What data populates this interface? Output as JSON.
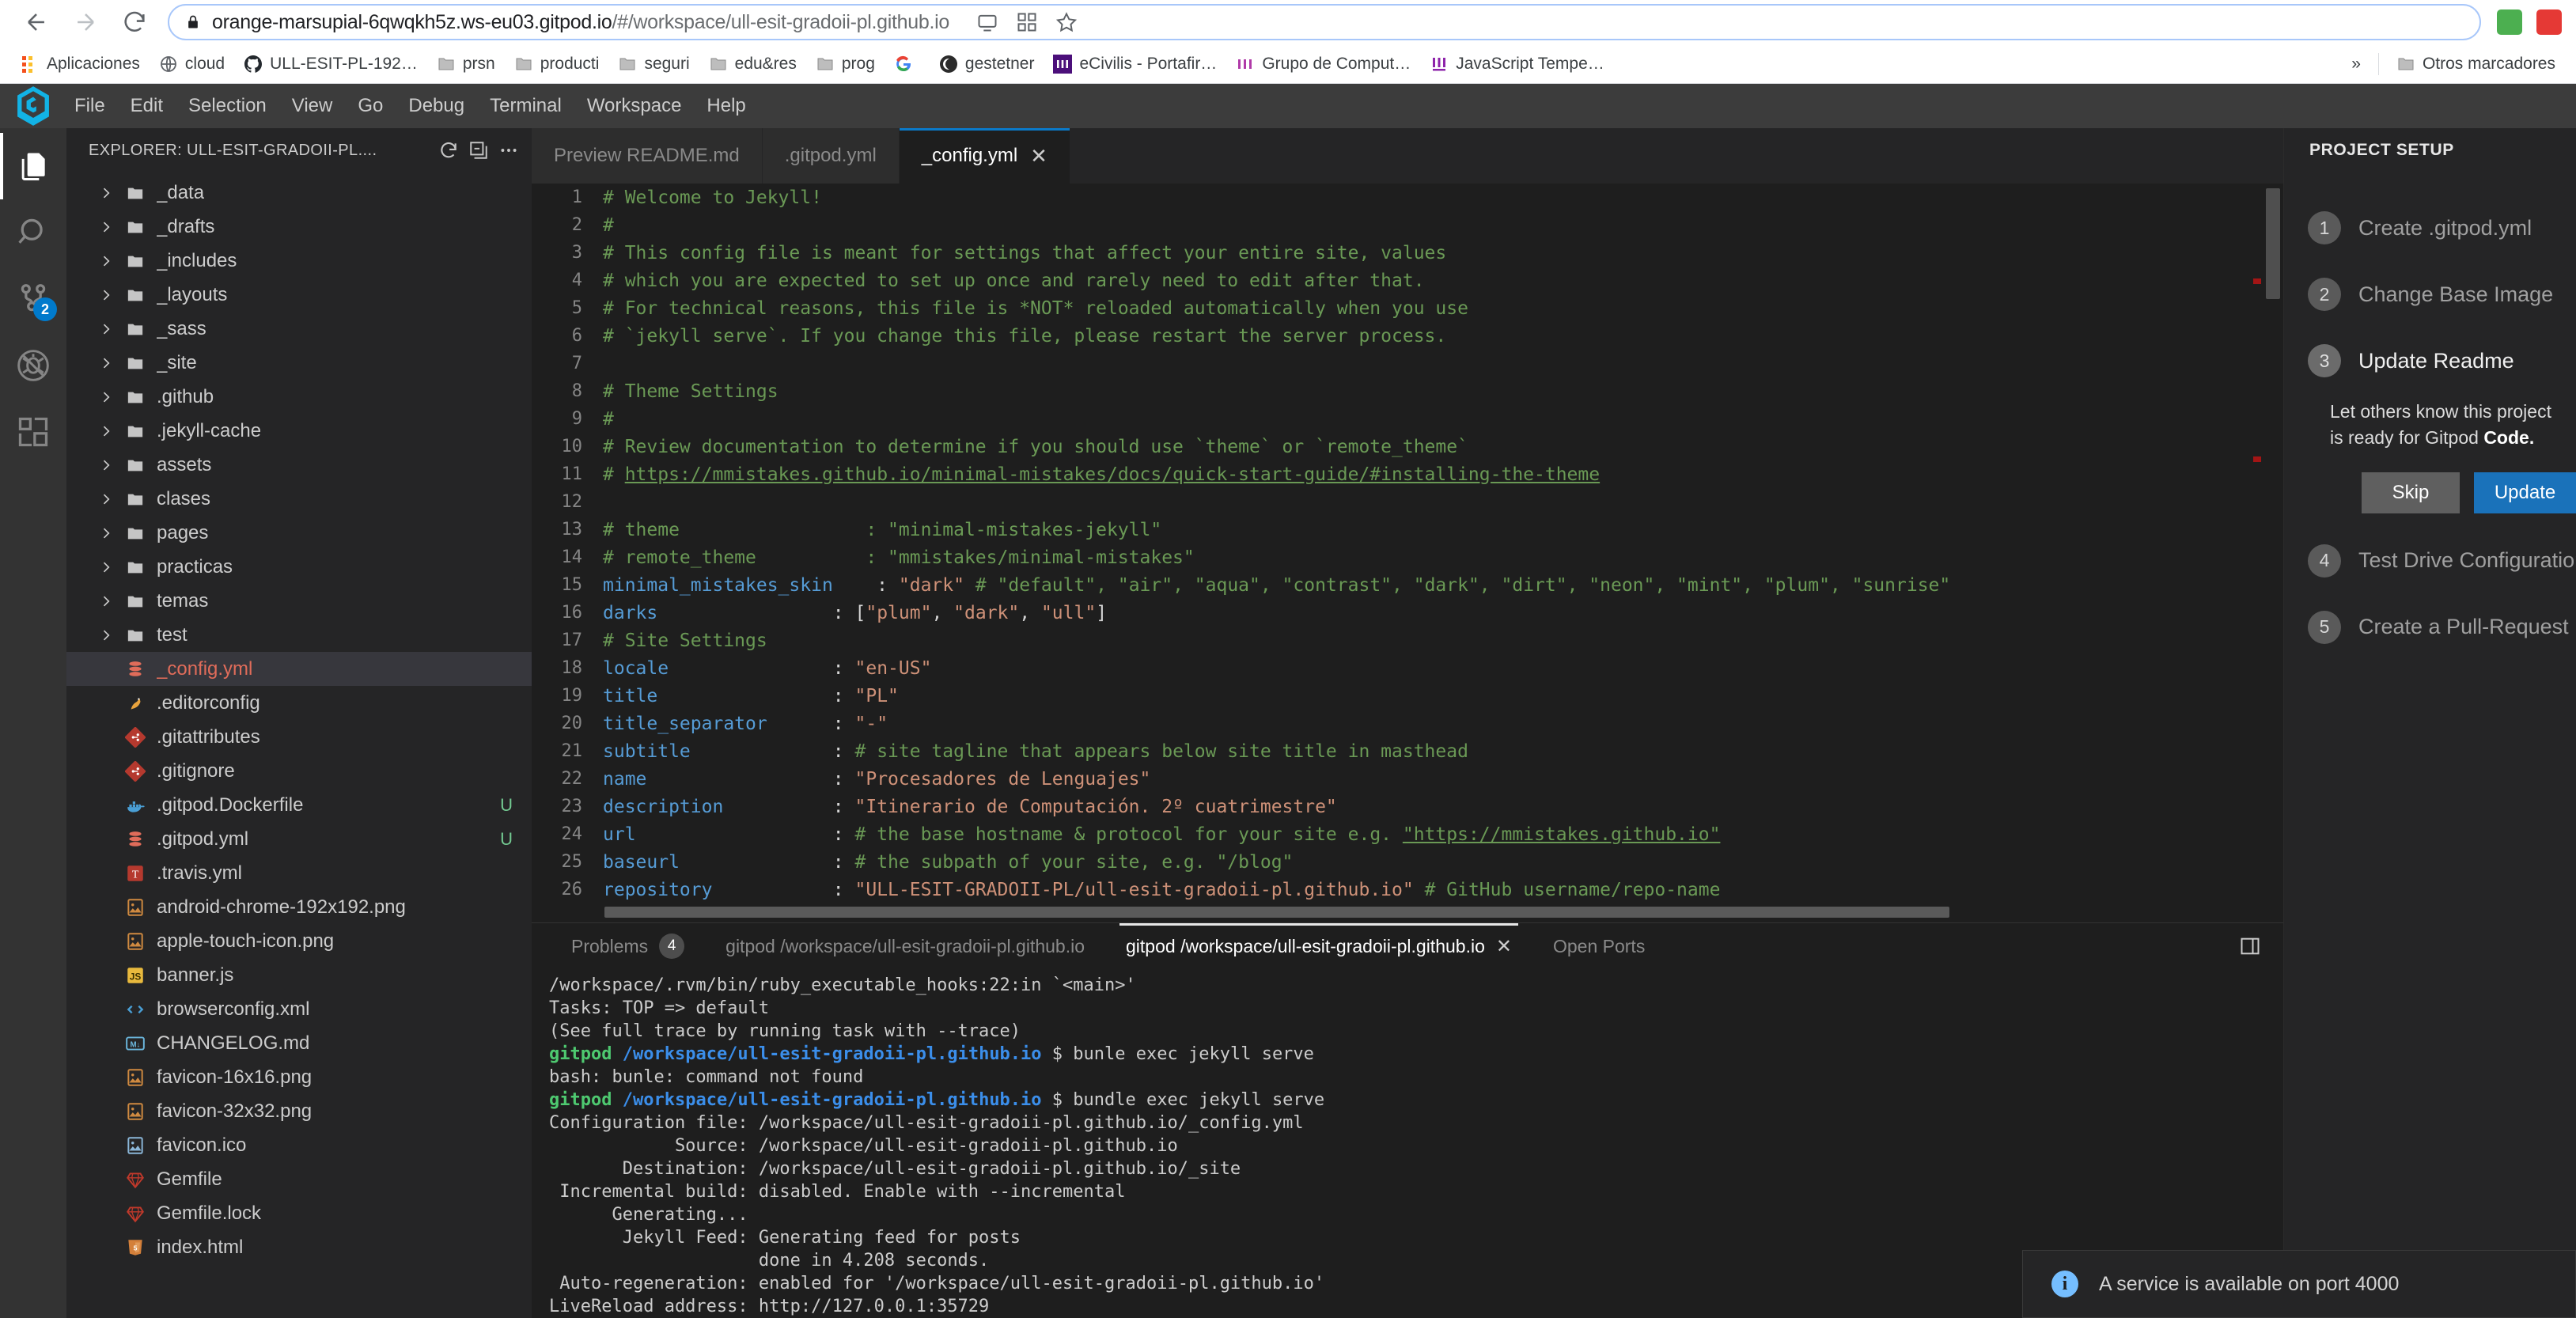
{
  "browser": {
    "url_main": "orange-marsupial-6qwqkh5z.ws-eu03.gitpod.io",
    "url_path": "/#/workspace/ull-esit-gradoii-pl.github.io",
    "back_label": "Back",
    "forward_label": "Forward",
    "reload_label": "Reload",
    "lock_label": "View site information",
    "bookmarks": [
      {
        "label": "Aplicaciones",
        "icon": "apps-grid-icon"
      },
      {
        "label": "cloud",
        "icon": "folder-icon"
      },
      {
        "label": "ULL-ESIT-PL-192…",
        "icon": "github-icon"
      },
      {
        "label": "prsn",
        "icon": "folder-icon"
      },
      {
        "label": "producti",
        "icon": "folder-icon"
      },
      {
        "label": "seguri",
        "icon": "folder-icon"
      },
      {
        "label": "edu&res",
        "icon": "folder-icon"
      },
      {
        "label": "prog",
        "icon": "folder-icon"
      },
      {
        "label": "",
        "icon": "google-icon"
      },
      {
        "label": "gestetner",
        "icon": "gestetner-icon"
      },
      {
        "label": "eCivilis - Portafir…",
        "icon": "ecivilis-icon"
      },
      {
        "label": "Grupo de Comput…",
        "icon": "ull-icon"
      },
      {
        "label": "JavaScript Tempe…",
        "icon": "ull-icon"
      }
    ],
    "overflow_label": "»",
    "other_bookmarks": "Otros marcadores"
  },
  "ide": {
    "menus": [
      "File",
      "Edit",
      "Selection",
      "View",
      "Go",
      "Debug",
      "Terminal",
      "Workspace",
      "Help"
    ],
    "logo_name": "gitpod-logo",
    "activitybar": [
      {
        "name": "explorer-icon",
        "badge": null,
        "active": true
      },
      {
        "name": "search-icon",
        "badge": null,
        "active": false
      },
      {
        "name": "source-control-icon",
        "badge": "2",
        "active": false
      },
      {
        "name": "debug-icon",
        "badge": null,
        "active": false
      },
      {
        "name": "extensions-icon",
        "badge": null,
        "active": false
      }
    ],
    "sidebar": {
      "title": "EXPLORER: ULL-ESIT-GRADOII-PL....",
      "actions": [
        "refresh-icon",
        "collapse-all-icon",
        "more-actions-icon"
      ],
      "tree": [
        {
          "name": "_data",
          "type": "folder"
        },
        {
          "name": "_drafts",
          "type": "folder"
        },
        {
          "name": "_includes",
          "type": "folder"
        },
        {
          "name": "_layouts",
          "type": "folder"
        },
        {
          "name": "_sass",
          "type": "folder"
        },
        {
          "name": "_site",
          "type": "folder"
        },
        {
          "name": ".github",
          "type": "folder"
        },
        {
          "name": ".jekyll-cache",
          "type": "folder"
        },
        {
          "name": "assets",
          "type": "folder"
        },
        {
          "name": "clases",
          "type": "folder"
        },
        {
          "name": "pages",
          "type": "folder"
        },
        {
          "name": "practicas",
          "type": "folder"
        },
        {
          "name": "temas",
          "type": "folder"
        },
        {
          "name": "test",
          "type": "folder"
        },
        {
          "name": "_config.yml",
          "type": "file",
          "icon": "yaml-icon",
          "selected": true,
          "status": ""
        },
        {
          "name": ".editorconfig",
          "type": "file",
          "icon": "editorconfig-icon",
          "status": ""
        },
        {
          "name": ".gitattributes",
          "type": "file",
          "icon": "git-icon",
          "status": ""
        },
        {
          "name": ".gitignore",
          "type": "file",
          "icon": "git-icon",
          "status": ""
        },
        {
          "name": ".gitpod.Dockerfile",
          "type": "file",
          "icon": "docker-icon",
          "status": "U"
        },
        {
          "name": ".gitpod.yml",
          "type": "file",
          "icon": "yaml-icon",
          "status": "U"
        },
        {
          "name": ".travis.yml",
          "type": "file",
          "icon": "travis-icon",
          "status": ""
        },
        {
          "name": "android-chrome-192x192.png",
          "type": "file",
          "icon": "image-icon",
          "status": ""
        },
        {
          "name": "apple-touch-icon.png",
          "type": "file",
          "icon": "image-icon",
          "status": ""
        },
        {
          "name": "banner.js",
          "type": "file",
          "icon": "js-icon",
          "status": ""
        },
        {
          "name": "browserconfig.xml",
          "type": "file",
          "icon": "xml-icon",
          "status": ""
        },
        {
          "name": "CHANGELOG.md",
          "type": "file",
          "icon": "markdown-icon",
          "status": ""
        },
        {
          "name": "favicon-16x16.png",
          "type": "file",
          "icon": "image-icon",
          "status": ""
        },
        {
          "name": "favicon-32x32.png",
          "type": "file",
          "icon": "image-icon",
          "status": ""
        },
        {
          "name": "favicon.ico",
          "type": "file",
          "icon": "image-ico-icon",
          "status": ""
        },
        {
          "name": "Gemfile",
          "type": "file",
          "icon": "ruby-icon",
          "status": ""
        },
        {
          "name": "Gemfile.lock",
          "type": "file",
          "icon": "ruby-icon",
          "status": ""
        },
        {
          "name": "index.html",
          "type": "file",
          "icon": "html-icon",
          "status": ""
        }
      ]
    },
    "tabs": [
      {
        "label": "Preview README.md",
        "active": false,
        "closable": false
      },
      {
        "label": ".gitpod.yml",
        "active": false,
        "closable": false
      },
      {
        "label": "_config.yml",
        "active": true,
        "closable": true
      }
    ],
    "editor": {
      "filename": "_config.yml",
      "lines": [
        {
          "n": 1,
          "segs": [
            {
              "t": "# Welcome to Jekyll!",
              "c": "c-com"
            }
          ]
        },
        {
          "n": 2,
          "segs": [
            {
              "t": "#",
              "c": "c-com"
            }
          ]
        },
        {
          "n": 3,
          "segs": [
            {
              "t": "# This config file is meant for settings that affect your entire site, values",
              "c": "c-com"
            }
          ]
        },
        {
          "n": 4,
          "segs": [
            {
              "t": "# which you are expected to set up once and rarely need to edit after that.",
              "c": "c-com"
            }
          ]
        },
        {
          "n": 5,
          "segs": [
            {
              "t": "# For technical reasons, this file is *NOT* reloaded automatically when you use",
              "c": "c-com"
            }
          ]
        },
        {
          "n": 6,
          "segs": [
            {
              "t": "# `jekyll serve`. If you change this file, please restart the server process.",
              "c": "c-com"
            }
          ]
        },
        {
          "n": 7,
          "segs": []
        },
        {
          "n": 8,
          "segs": [
            {
              "t": "# Theme Settings",
              "c": "c-com"
            }
          ]
        },
        {
          "n": 9,
          "segs": [
            {
              "t": "#",
              "c": "c-com"
            }
          ]
        },
        {
          "n": 10,
          "segs": [
            {
              "t": "# Review documentation to determine if you should use `theme` or `remote_theme`",
              "c": "c-com"
            }
          ]
        },
        {
          "n": 11,
          "segs": [
            {
              "t": "# ",
              "c": "c-com"
            },
            {
              "t": "https://mmistakes.github.io/minimal-mistakes/docs/quick-start-guide/#installing-the-theme",
              "c": "c-lnk"
            }
          ]
        },
        {
          "n": 12,
          "segs": []
        },
        {
          "n": 13,
          "segs": [
            {
              "t": "# theme                 : \"minimal-mistakes-jekyll\"",
              "c": "c-com"
            }
          ]
        },
        {
          "n": 14,
          "segs": [
            {
              "t": "# remote_theme          : \"mmistakes/minimal-mistakes\"",
              "c": "c-com"
            }
          ]
        },
        {
          "n": 15,
          "segs": [
            {
              "t": "minimal_mistakes_skin",
              "c": "c-key"
            },
            {
              "t": "    : ",
              "c": "c-pun"
            },
            {
              "t": "\"dark\"",
              "c": "c-str"
            },
            {
              "t": " # \"default\", \"air\", \"aqua\", \"contrast\", \"dark\", \"dirt\", \"neon\", \"mint\", \"plum\", \"sunrise\"",
              "c": "c-com"
            }
          ]
        },
        {
          "n": 16,
          "segs": [
            {
              "t": "darks",
              "c": "c-key"
            },
            {
              "t": "                : [",
              "c": "c-pun"
            },
            {
              "t": "\"plum\"",
              "c": "c-str"
            },
            {
              "t": ", ",
              "c": "c-pun"
            },
            {
              "t": "\"dark\"",
              "c": "c-str"
            },
            {
              "t": ", ",
              "c": "c-pun"
            },
            {
              "t": "\"ull\"",
              "c": "c-str"
            },
            {
              "t": "]",
              "c": "c-pun"
            }
          ]
        },
        {
          "n": 17,
          "segs": [
            {
              "t": "# Site Settings",
              "c": "c-com"
            }
          ]
        },
        {
          "n": 18,
          "segs": [
            {
              "t": "locale",
              "c": "c-key"
            },
            {
              "t": "               : ",
              "c": "c-pun"
            },
            {
              "t": "\"en-US\"",
              "c": "c-str"
            }
          ]
        },
        {
          "n": 19,
          "segs": [
            {
              "t": "title",
              "c": "c-key"
            },
            {
              "t": "                : ",
              "c": "c-pun"
            },
            {
              "t": "\"PL\"",
              "c": "c-str"
            }
          ]
        },
        {
          "n": 20,
          "segs": [
            {
              "t": "title_separator",
              "c": "c-key"
            },
            {
              "t": "      : ",
              "c": "c-pun"
            },
            {
              "t": "\"-\"",
              "c": "c-str"
            }
          ]
        },
        {
          "n": 21,
          "segs": [
            {
              "t": "subtitle",
              "c": "c-key"
            },
            {
              "t": "             : ",
              "c": "c-pun"
            },
            {
              "t": "# site tagline that appears below site title in masthead",
              "c": "c-com"
            }
          ]
        },
        {
          "n": 22,
          "segs": [
            {
              "t": "name",
              "c": "c-key"
            },
            {
              "t": "                 : ",
              "c": "c-pun"
            },
            {
              "t": "\"Procesadores de Lenguajes\"",
              "c": "c-str"
            }
          ]
        },
        {
          "n": 23,
          "segs": [
            {
              "t": "description",
              "c": "c-key"
            },
            {
              "t": "          : ",
              "c": "c-pun"
            },
            {
              "t": "\"Itinerario de Computación. 2º cuatrimestre\"",
              "c": "c-str"
            }
          ]
        },
        {
          "n": 24,
          "segs": [
            {
              "t": "url",
              "c": "c-key"
            },
            {
              "t": "                  : ",
              "c": "c-pun"
            },
            {
              "t": "# the base hostname & protocol for your site e.g. ",
              "c": "c-com"
            },
            {
              "t": "\"https://mmistakes.github.io\"",
              "c": "c-lnk"
            }
          ]
        },
        {
          "n": 25,
          "segs": [
            {
              "t": "baseurl",
              "c": "c-key"
            },
            {
              "t": "              : ",
              "c": "c-pun"
            },
            {
              "t": "# the subpath of your site, e.g. \"/blog\"",
              "c": "c-com"
            }
          ]
        },
        {
          "n": 26,
          "segs": [
            {
              "t": "repository",
              "c": "c-key"
            },
            {
              "t": "           : ",
              "c": "c-pun"
            },
            {
              "t": "\"ULL-ESIT-GRADOII-PL/ull-esit-gradoii-pl.github.io\"",
              "c": "c-str"
            },
            {
              "t": " # GitHub username/repo-name",
              "c": "c-com"
            }
          ]
        }
      ]
    },
    "panel": {
      "tabs": [
        {
          "label": "Problems",
          "badge": "4",
          "active": false,
          "closable": false
        },
        {
          "label": "gitpod /workspace/ull-esit-gradoii-pl.github.io",
          "badge": null,
          "active": false,
          "closable": false
        },
        {
          "label": "gitpod /workspace/ull-esit-gradoii-pl.github.io",
          "badge": null,
          "active": true,
          "closable": true
        },
        {
          "label": "Open Ports",
          "badge": null,
          "active": false,
          "closable": false
        }
      ],
      "action_icon": "split-panel-icon",
      "terminal": [
        {
          "segs": [
            {
              "t": "/workspace/.rvm/bin/ruby_executable_hooks:22:in `<main>'",
              "c": ""
            }
          ]
        },
        {
          "segs": [
            {
              "t": "Tasks: TOP => default",
              "c": ""
            }
          ]
        },
        {
          "segs": [
            {
              "t": "(See full trace by running task with --trace)",
              "c": ""
            }
          ]
        },
        {
          "segs": [
            {
              "t": "gitpod",
              "c": "t-grn"
            },
            {
              "t": " ",
              "c": ""
            },
            {
              "t": "/workspace/ull-esit-gradoii-pl.github.io",
              "c": "t-blu"
            },
            {
              "t": " $ bunle exec jekyll serve",
              "c": ""
            }
          ]
        },
        {
          "segs": [
            {
              "t": "bash: bunle: command not found",
              "c": ""
            }
          ]
        },
        {
          "segs": [
            {
              "t": "gitpod",
              "c": "t-grn"
            },
            {
              "t": " ",
              "c": ""
            },
            {
              "t": "/workspace/ull-esit-gradoii-pl.github.io",
              "c": "t-blu"
            },
            {
              "t": " $ bundle exec jekyll serve",
              "c": ""
            }
          ]
        },
        {
          "segs": [
            {
              "t": "Configuration file: /workspace/ull-esit-gradoii-pl.github.io/_config.yml",
              "c": ""
            }
          ]
        },
        {
          "segs": [
            {
              "t": "            Source: /workspace/ull-esit-gradoii-pl.github.io",
              "c": ""
            }
          ]
        },
        {
          "segs": [
            {
              "t": "       Destination: /workspace/ull-esit-gradoii-pl.github.io/_site",
              "c": ""
            }
          ]
        },
        {
          "segs": [
            {
              "t": " Incremental build: disabled. Enable with --incremental",
              "c": ""
            }
          ]
        },
        {
          "segs": [
            {
              "t": "      Generating...",
              "c": ""
            }
          ]
        },
        {
          "segs": [
            {
              "t": "       Jekyll Feed: Generating feed for posts",
              "c": ""
            }
          ]
        },
        {
          "segs": [
            {
              "t": "                    done in 4.208 seconds.",
              "c": ""
            }
          ]
        },
        {
          "segs": [
            {
              "t": " Auto-regeneration: enabled for '/workspace/ull-esit-gradoii-pl.github.io'",
              "c": ""
            }
          ]
        },
        {
          "segs": [
            {
              "t": "LiveReload address: http://127.0.0.1:35729",
              "c": ""
            }
          ]
        }
      ]
    },
    "rightpanel": {
      "title": "PROJECT SETUP",
      "steps": [
        {
          "num": "1",
          "label": "Create .gitpod.yml",
          "active": false
        },
        {
          "num": "2",
          "label": "Change Base Image",
          "active": false
        },
        {
          "num": "3",
          "label": "Update Readme",
          "active": true
        },
        {
          "num": "4",
          "label": "Test Drive Configuration",
          "active": false
        },
        {
          "num": "5",
          "label": "Create a Pull-Request",
          "active": false
        }
      ],
      "body_text": "Let others know this project is ready for Gitpod ",
      "body_bold": "Code.",
      "skip_label": "Skip",
      "primary_label": "Update"
    },
    "toast": {
      "icon": "info-icon",
      "message": "A service is available on port 4000"
    }
  }
}
